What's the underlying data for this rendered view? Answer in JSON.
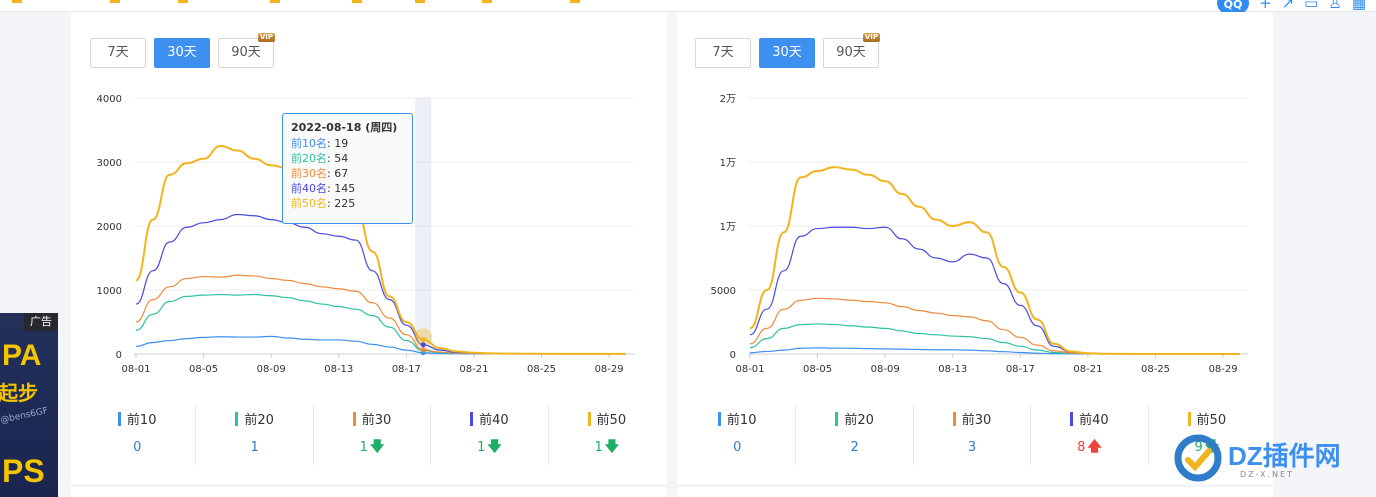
{
  "top_icons": [
    "qq-icon",
    "plus-icon",
    "share-icon",
    "box-icon",
    "user-icon",
    "grid-icon"
  ],
  "left": {
    "buttons": [
      {
        "label": "7天",
        "active": false
      },
      {
        "label": "30天",
        "active": true
      },
      {
        "label": "90天",
        "active": false,
        "badge": "VIP"
      }
    ],
    "tooltip": {
      "title": "2022-08-18 (周四)",
      "rows": [
        {
          "name": "前10名",
          "value": "19",
          "color": "#3d8ff0"
        },
        {
          "name": "前20名",
          "value": "54",
          "color": "#2fc2a0"
        },
        {
          "name": "前30名",
          "value": "67",
          "color": "#f08a3c"
        },
        {
          "name": "前40名",
          "value": "145",
          "color": "#4a4adf"
        },
        {
          "name": "前50名",
          "value": "225",
          "color": "#f0b41e"
        }
      ]
    },
    "stats": [
      {
        "label": "前10",
        "value": "0",
        "color": "#3d8ff0",
        "trend": ""
      },
      {
        "label": "前20",
        "value": "1",
        "color": "#2fc2a0",
        "trend": ""
      },
      {
        "label": "前30",
        "value": "1",
        "color": "#f08a3c",
        "trend": "down"
      },
      {
        "label": "前40",
        "value": "1",
        "color": "#4a4adf",
        "trend": "down"
      },
      {
        "label": "前50",
        "value": "1",
        "color": "#f0b41e",
        "trend": "down"
      }
    ]
  },
  "right": {
    "buttons": [
      {
        "label": "7天",
        "active": false
      },
      {
        "label": "30天",
        "active": true
      },
      {
        "label": "90天",
        "active": false,
        "badge": "VIP"
      }
    ],
    "stats": [
      {
        "label": "前10",
        "value": "0",
        "color": "#3d8ff0",
        "trend": ""
      },
      {
        "label": "前20",
        "value": "2",
        "color": "#2fc2a0",
        "trend": ""
      },
      {
        "label": "前30",
        "value": "3",
        "color": "#f08a3c",
        "trend": ""
      },
      {
        "label": "前40",
        "value": "8",
        "color": "#4a4adf",
        "trend": "up"
      },
      {
        "label": "前50",
        "value": "9",
        "color": "#f0b41e",
        "trend": "down"
      }
    ]
  },
  "ad": {
    "tag": "广告",
    "line1": "PA",
    "line2": "起步",
    "line3": "@bens6GF",
    "line4": "PS"
  },
  "watermark": {
    "text": "DZ插件网",
    "sub": "DZ-X.NET"
  },
  "chart_data": [
    {
      "type": "line",
      "title": "",
      "ylim": [
        0,
        4000
      ],
      "y_ticks": [
        "0",
        "1000",
        "2000",
        "3000",
        "4000"
      ],
      "x_ticks": [
        "08-01",
        "08-05",
        "08-09",
        "08-13",
        "08-17",
        "08-21",
        "08-25",
        "08-29"
      ],
      "highlight_index": 17,
      "series": [
        {
          "name": "前10名",
          "color": "#3d8ff0",
          "values": [
            120,
            180,
            210,
            240,
            260,
            270,
            265,
            265,
            275,
            250,
            230,
            220,
            220,
            200,
            150,
            110,
            60,
            19,
            8,
            4,
            2,
            1,
            1,
            0,
            0,
            0,
            0,
            0,
            0,
            0
          ]
        },
        {
          "name": "前20名",
          "color": "#2fc2a0",
          "values": [
            370,
            620,
            820,
            900,
            920,
            930,
            920,
            930,
            910,
            880,
            830,
            780,
            740,
            700,
            600,
            420,
            210,
            54,
            22,
            10,
            5,
            3,
            2,
            1,
            1,
            1,
            1,
            1,
            1,
            1
          ]
        },
        {
          "name": "前30名",
          "color": "#f08a3c",
          "values": [
            500,
            850,
            1050,
            1180,
            1210,
            1200,
            1230,
            1220,
            1180,
            1150,
            1100,
            1050,
            1020,
            980,
            800,
            560,
            300,
            67,
            30,
            15,
            8,
            4,
            3,
            2,
            2,
            1,
            1,
            1,
            1,
            1
          ]
        },
        {
          "name": "前40名",
          "color": "#4a4adf",
          "values": [
            780,
            1300,
            1750,
            1980,
            2050,
            2100,
            2180,
            2160,
            2100,
            2050,
            1980,
            1880,
            1840,
            1780,
            1300,
            850,
            450,
            145,
            60,
            25,
            12,
            6,
            4,
            3,
            2,
            2,
            1,
            1,
            1,
            1
          ]
        },
        {
          "name": "前50名",
          "color": "#f0b41e",
          "values": [
            1150,
            2100,
            2800,
            2980,
            3050,
            3250,
            3180,
            3050,
            2950,
            2900,
            2850,
            2750,
            2500,
            2300,
            1600,
            900,
            500,
            225,
            90,
            40,
            20,
            10,
            6,
            4,
            3,
            2,
            2,
            1,
            1,
            1
          ]
        }
      ]
    },
    {
      "type": "line",
      "title": "",
      "ylim": [
        0,
        20000
      ],
      "y_ticks": [
        "0",
        "5000",
        "1万",
        "1万",
        "2万"
      ],
      "x_ticks": [
        "08-01",
        "08-05",
        "08-09",
        "08-13",
        "08-17",
        "08-21",
        "08-25",
        "08-29"
      ],
      "series": [
        {
          "name": "前10名",
          "color": "#3d8ff0",
          "values": [
            100,
            200,
            300,
            450,
            480,
            460,
            450,
            420,
            400,
            380,
            350,
            330,
            330,
            300,
            250,
            180,
            120,
            60,
            30,
            15,
            8,
            4,
            2,
            1,
            1,
            1,
            1,
            1,
            1,
            1
          ]
        },
        {
          "name": "前20名",
          "color": "#2fc2a0",
          "values": [
            500,
            1200,
            2000,
            2300,
            2350,
            2300,
            2200,
            2100,
            2000,
            1800,
            1600,
            1500,
            1400,
            1350,
            1200,
            900,
            600,
            300,
            120,
            50,
            20,
            10,
            5,
            3,
            2,
            1,
            1,
            1,
            1,
            1
          ]
        },
        {
          "name": "前30名",
          "color": "#f08a3c",
          "values": [
            800,
            2000,
            3500,
            4200,
            4350,
            4300,
            4200,
            4100,
            4000,
            3700,
            3400,
            3200,
            3000,
            2900,
            2600,
            1900,
            1300,
            700,
            250,
            80,
            30,
            10,
            5,
            3,
            2,
            1,
            1,
            1,
            1,
            1
          ]
        },
        {
          "name": "前40名",
          "color": "#4a4adf",
          "values": [
            1500,
            3500,
            6500,
            9200,
            9800,
            9900,
            9900,
            9800,
            9900,
            9000,
            8200,
            7500,
            7200,
            7800,
            7500,
            5500,
            3800,
            2200,
            600,
            150,
            40,
            15,
            6,
            3,
            2,
            1,
            1,
            1,
            1,
            1
          ]
        },
        {
          "name": "前50名",
          "color": "#f0b41e",
          "values": [
            2000,
            5000,
            9500,
            13800,
            14300,
            14600,
            14400,
            14000,
            13500,
            12500,
            11500,
            10500,
            10000,
            10300,
            9500,
            6800,
            4800,
            2700,
            800,
            200,
            60,
            20,
            8,
            4,
            2,
            1,
            1,
            1,
            1,
            1
          ]
        }
      ]
    }
  ]
}
